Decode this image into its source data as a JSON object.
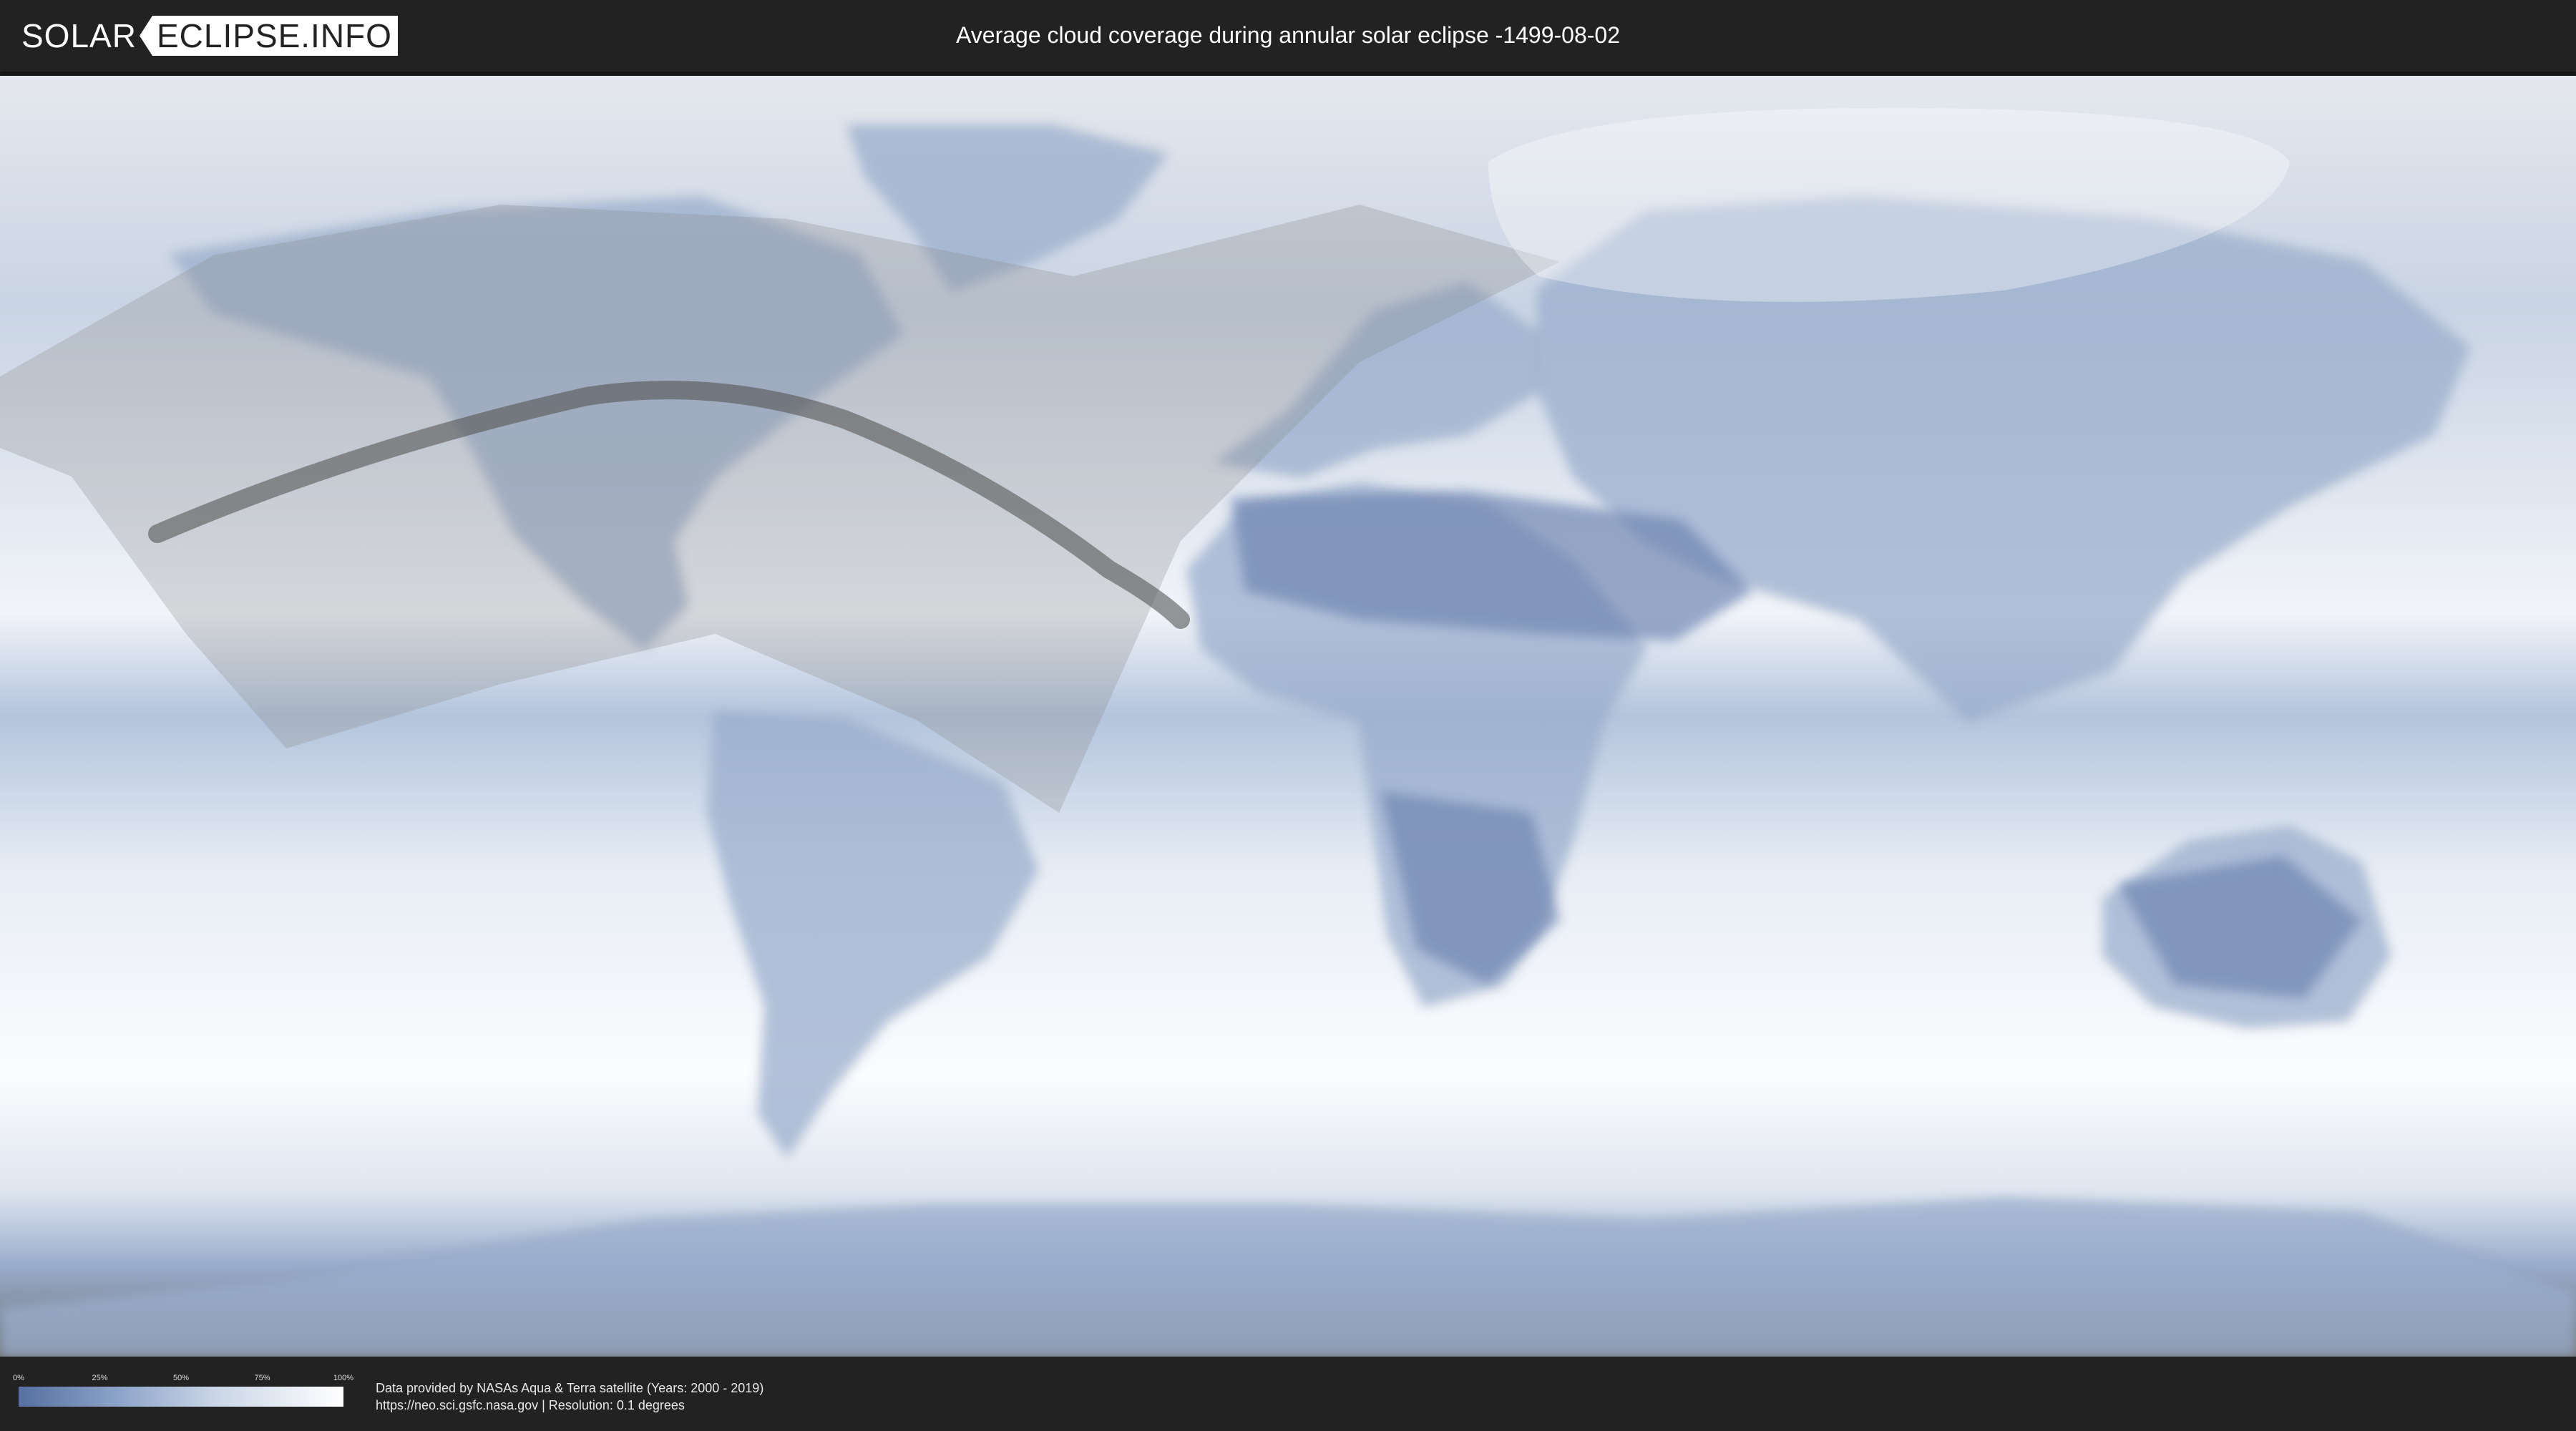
{
  "header": {
    "logo_solar": "SOLAR",
    "logo_domain": "ECLIPSE.INFO",
    "title": "Average cloud coverage during annular solar eclipse -1499-08-02"
  },
  "map": {
    "type": "equirectangular world cloud-coverage map",
    "colors": {
      "clear_sky": "#5670a0",
      "cloudy": "#ffffff",
      "visibility_zone_overlay": "#7a7a7a",
      "central_path": "#555555"
    },
    "icons": [
      "visibility-zone-overlay",
      "annularity-path",
      "polar-visibility-zone"
    ]
  },
  "legend": {
    "ticks": [
      "0%",
      "25%",
      "50%",
      "75%",
      "100%"
    ],
    "tick_values": [
      0,
      25,
      50,
      75,
      100
    ]
  },
  "credits": {
    "line1": "Data provided by NASAs Aqua & Terra satellite (Years: 2000 - 2019)",
    "line2": "https://neo.sci.gsfc.nasa.gov | Resolution: 0.1 degrees"
  }
}
